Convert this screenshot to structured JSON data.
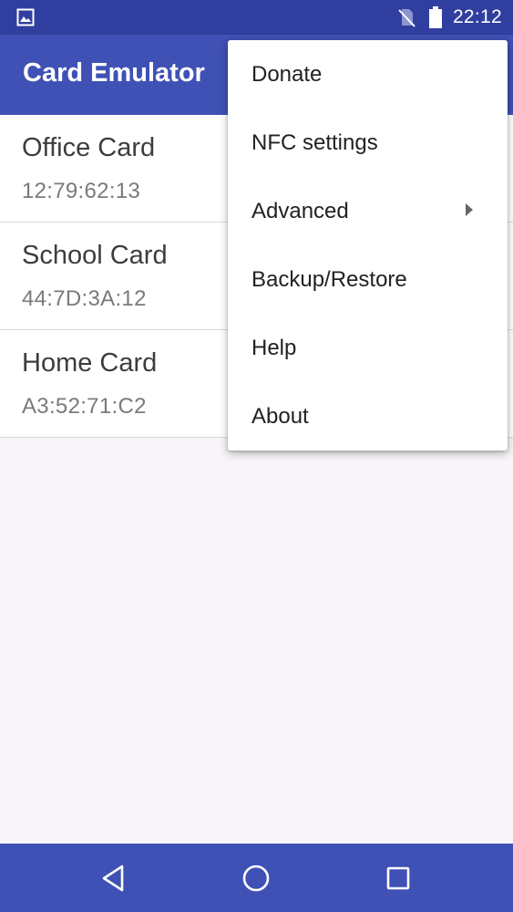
{
  "status_bar": {
    "time": "22:12",
    "left_icon": "image-notification-icon",
    "sim_icon": "no-sim-icon",
    "battery_icon": "battery-icon"
  },
  "app_bar": {
    "title": "Card Emulator"
  },
  "cards": [
    {
      "name": "Office Card",
      "id": "12:79:62:13"
    },
    {
      "name": "School Card",
      "id": "44:7D:3A:12"
    },
    {
      "name": "Home Card",
      "id": "A3:52:71:C2"
    }
  ],
  "overflow_menu": {
    "items": [
      {
        "label": "Donate"
      },
      {
        "label": "NFC settings"
      },
      {
        "label": "Advanced",
        "has_submenu": true
      },
      {
        "label": "Backup/Restore"
      },
      {
        "label": "Help"
      },
      {
        "label": "About"
      }
    ]
  },
  "nav_bar": {
    "back_icon": "back-icon",
    "home_icon": "home-icon",
    "recents_icon": "recents-icon"
  },
  "colors": {
    "primary": "#3f51b5",
    "primary_dark": "#303f9f",
    "background": "#f7f5f7"
  }
}
